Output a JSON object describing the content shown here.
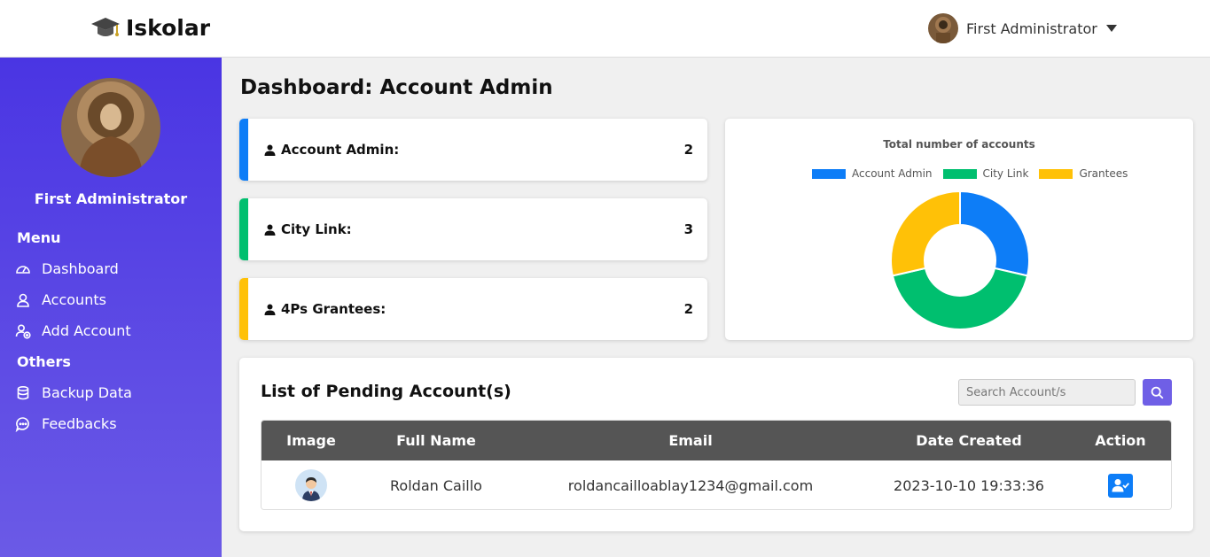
{
  "app": {
    "name": "Iskolar"
  },
  "header": {
    "user_name": "First Administrator"
  },
  "sidebar": {
    "user_name": "First Administrator",
    "menu_heading": "Menu",
    "menu_items": [
      {
        "label": "Dashboard",
        "icon": "gauge-icon"
      },
      {
        "label": "Accounts",
        "icon": "user-icon"
      },
      {
        "label": "Add Account",
        "icon": "user-add-icon"
      }
    ],
    "others_heading": "Others",
    "other_items": [
      {
        "label": "Backup Data",
        "icon": "database-icon"
      },
      {
        "label": "Feedbacks",
        "icon": "chat-icon"
      }
    ]
  },
  "page": {
    "title": "Dashboard: Account Admin"
  },
  "stats": [
    {
      "label": "Account Admin:",
      "value": "2",
      "color": "#0d7df7"
    },
    {
      "label": "City Link:",
      "value": "3",
      "color": "#00bf6f"
    },
    {
      "label": "4Ps Grantees:",
      "value": "2",
      "color": "#ffc107"
    }
  ],
  "chart_data": {
    "type": "pie",
    "title": "Total number of accounts",
    "categories": [
      "Account Admin",
      "City Link",
      "Grantees"
    ],
    "values": [
      2,
      3,
      2
    ],
    "colors": [
      "#0d7df7",
      "#00bf6f",
      "#ffc107"
    ],
    "legend": "top"
  },
  "pending": {
    "title": "List of Pending Account(s)",
    "search_placeholder": "Search Account/s",
    "columns": [
      "Image",
      "Full Name",
      "Email",
      "Date Created",
      "Action"
    ],
    "rows": [
      {
        "full_name": "Roldan Caillo",
        "email": "roldancailloablay1234@gmail.com",
        "date_created": "2023-10-10 19:33:36"
      }
    ]
  }
}
